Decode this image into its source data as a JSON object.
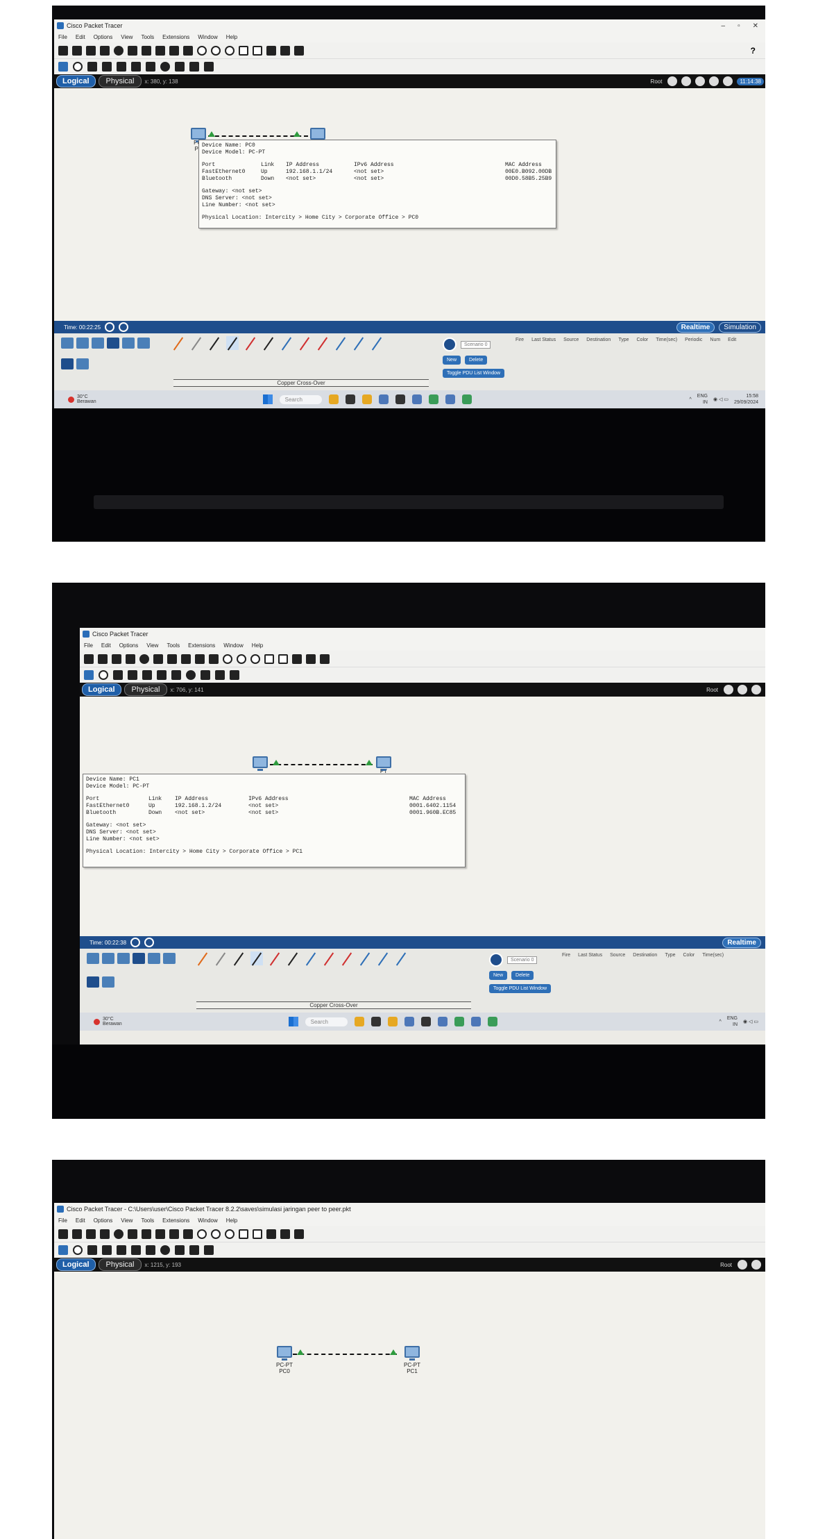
{
  "common": {
    "app_title": "Cisco Packet Tracer",
    "menu": [
      "File",
      "Edit",
      "Options",
      "View",
      "Tools",
      "Extensions",
      "Window",
      "Help"
    ],
    "help_label": "?",
    "tab_logical": "Logical",
    "tab_physical": "Physical",
    "root_label": "Root",
    "realtime_label": "Realtime",
    "simulation_label": "Simulation",
    "cable_label": "Copper Cross-Over",
    "scenario_label": "Scenario 0",
    "new_label": "New",
    "delete_label": "Delete",
    "toggle_pdu_label": "Toggle PDU List Window",
    "pdu_columns": [
      "Fire",
      "Last Status",
      "Source",
      "Destination",
      "Type",
      "Color",
      "Time(sec)",
      "Periodic",
      "Num",
      "Edit"
    ],
    "weather_temp": "30°C",
    "weather_place": "Berawan",
    "search_placeholder": "Search",
    "lang": "ENG",
    "region": "IN",
    "colors": {
      "accent": "#1f5fa8",
      "link_light": "#2f9b3e",
      "workspace": "#f2f1ec"
    },
    "icons": [
      "cisco-logo-icon",
      "new-file-icon",
      "open-icon",
      "save-icon",
      "print-icon",
      "activity-wizard-icon",
      "undo-icon",
      "redo-icon",
      "zoom-in-icon",
      "zoom-out-icon",
      "select-icon",
      "inspect-icon",
      "delete-icon",
      "note-icon",
      "simple-pdu-icon",
      "complex-pdu-icon",
      "realtime-clock-icon",
      "fast-forward-icon"
    ]
  },
  "shots": [
    {
      "coords": "x: 380, y: 138",
      "clock": "11:14:38",
      "time": "Time: 00:22:25",
      "tray_time": "15:58",
      "tray_date": "29/09/2024",
      "devices": [
        {
          "model": "PC-",
          "name": "PC"
        },
        {
          "model": "",
          "name": ""
        }
      ],
      "popup": {
        "device_name": "Device Name: PC0",
        "device_model": "Device Model: PC-PT",
        "headers": [
          "Port",
          "Link",
          "IP Address",
          "IPv6 Address",
          "MAC Address"
        ],
        "rows": [
          [
            "FastEthernet0",
            "Up",
            "192.168.1.1/24",
            "<not set>",
            "00E0.B092.00DB"
          ],
          [
            "Bluetooth",
            "Down",
            "<not set>",
            "<not set>",
            "00D0.58B5.25B9"
          ]
        ],
        "gateway": "Gateway: <not set>",
        "dns": "DNS Server: <not set>",
        "line": "Line Number: <not set>",
        "location": "Physical Location: Intercity > Home City > Corporate Office > PC0"
      }
    },
    {
      "coords": "x: 706, y: 141",
      "time": "Time: 00:22:38",
      "devices": [
        {
          "model": "",
          "name": ""
        },
        {
          "model": "PT",
          "name": ""
        }
      ],
      "popup": {
        "device_name": "Device Name: PC1",
        "device_model": "Device Model: PC-PT",
        "headers": [
          "Port",
          "Link",
          "IP Address",
          "IPv6 Address",
          "MAC Address"
        ],
        "rows": [
          [
            "FastEthernet0",
            "Up",
            "192.168.1.2/24",
            "<not set>",
            "0001.6402.1154"
          ],
          [
            "Bluetooth",
            "Down",
            "<not set>",
            "<not set>",
            "0001.960B.EC85"
          ]
        ],
        "gateway": "Gateway: <not set>",
        "dns": "DNS Server: <not set>",
        "line": "Line Number: <not set>",
        "location": "Physical Location: Intercity > Home City > Corporate Office > PC1"
      }
    },
    {
      "title": "Cisco Packet Tracer - C:\\Users\\user\\Cisco Packet Tracer 8.2.2\\saves\\simulasi jaringan peer to peer.pkt",
      "coords": "x: 1215, y: 193",
      "devices": [
        {
          "model": "PC-PT",
          "name": "PC0"
        },
        {
          "model": "PC-PT",
          "name": "PC1"
        }
      ]
    }
  ]
}
